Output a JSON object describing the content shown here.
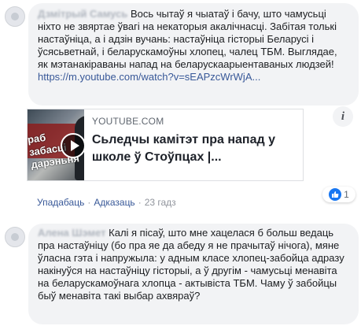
{
  "comment1": {
    "author": "Дзмітрый Самусь",
    "text": "Вось чытаў я чыатаў і бачу, што чамусьці ніхто не звяртае ўвагі на некаторыя акалічнасці. Забітая толькі настаўніца, а і адзін вучань: настаўніца гісторыі Беларусі і ўсясьветнай, і беларускамоўны хлопец, чалец ТБМ. Выглядае, як мэтанакіраваны напад на беларускаарыентаваных людзей!",
    "link": "https://m.youtube.com/watch?v=sEAPzcWrWjA...",
    "preview": {
      "domain": "YOUTUBE.COM",
      "title": "Сьледчы камітэт пра напад у школе ў Стоўпцах |...",
      "thumb_overlay": "раб забасці дарэньня"
    },
    "actions": {
      "like": "Упадабаць",
      "reply": "Адказаць",
      "sep": "·",
      "time": "23 гадз"
    },
    "reactions": {
      "count": "1",
      "icon": "thumbs-up-icon"
    }
  },
  "comment2": {
    "author": "Алена Шэмет",
    "text": "Калі я пісаў, што мне хацелася б больш ведаць пра настаўніцу (бо пра яе да абеду я не прачытаў нічога), мяне ўласна гэта і напружыла: у адным класе хлопец-забойца адразу накінуўся на настаўніцу гісторыі, а ў другім - чамусьці менавіта на беларускамоўнага хлопца - актывіста ТБМ. Чаму ў забойцы быў менавіта такі выбар ахвяраў?"
  },
  "colors": {
    "bubble": "#f2f3f5",
    "link": "#385898",
    "like": "#1877f2"
  }
}
